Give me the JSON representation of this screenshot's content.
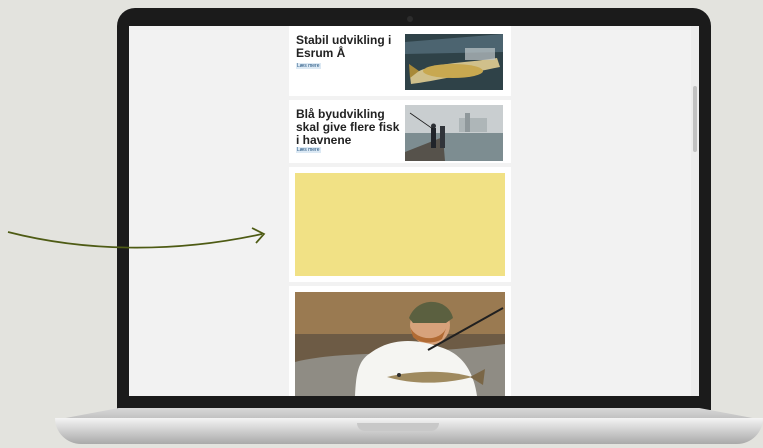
{
  "cards": [
    {
      "title": "Stabil udvikling i Esrum Å",
      "read_more": "Læs mere",
      "image": "fish-on-net-photo"
    },
    {
      "title": "Blå byudvikling skal give flere fisk i havnene",
      "read_more": "Læs mere",
      "image": "harbor-anglers-photo"
    }
  ],
  "ad": {
    "color": "#f1e185"
  },
  "hero": {
    "image": "angler-holding-trout-photo"
  },
  "annotation": {
    "icon": "pointer-arrow-icon",
    "color": "#4e5b14"
  }
}
